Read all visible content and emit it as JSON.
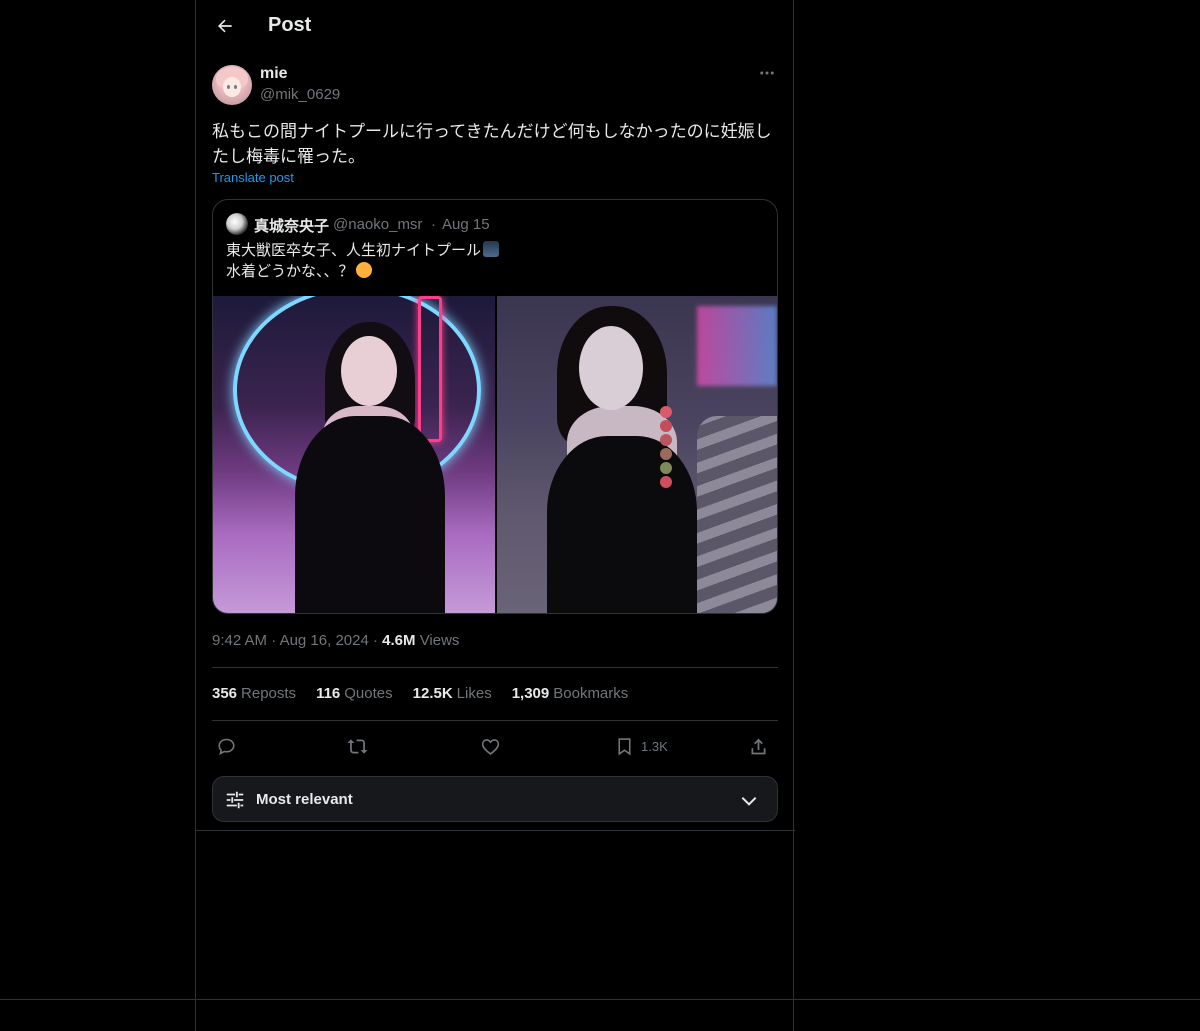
{
  "header": {
    "title": "Post"
  },
  "post": {
    "author_name": "mie",
    "author_handle": "@mik_0629",
    "text": "私もこの間ナイトプールに行ってきたんだけど何もしなかったのに妊娠したし梅毒に罹った。",
    "translate_label": "Translate post",
    "time": "9:42 AM",
    "date": "Aug 16, 2024",
    "views_count": "4.6M",
    "views_label": "Views"
  },
  "quote": {
    "author_name": "真城奈央子",
    "author_handle": "@naoko_msr",
    "separator": "·",
    "date": "Aug 15",
    "line1": "東大獣医卒女子、人生初ナイトプール",
    "line2": "水着どうかな、、？"
  },
  "stats": {
    "reposts_n": "356",
    "reposts_label": "Reposts",
    "quotes_n": "116",
    "quotes_label": "Quotes",
    "likes_n": "12.5K",
    "likes_label": "Likes",
    "bookmarks_n": "1,309",
    "bookmarks_label": "Bookmarks"
  },
  "actions": {
    "reply_icon": "reply-icon",
    "repost_icon": "repost-icon",
    "like_icon": "heart-icon",
    "bookmark_icon": "bookmark-icon",
    "bookmark_count": "1.3K",
    "share_icon": "share-icon"
  },
  "sort": {
    "label": "Most relevant"
  },
  "colors": {
    "background": "#000000",
    "text": "#e7e9ea",
    "muted": "#71767b",
    "link": "#1d9bf0",
    "border": "#2f3336"
  }
}
